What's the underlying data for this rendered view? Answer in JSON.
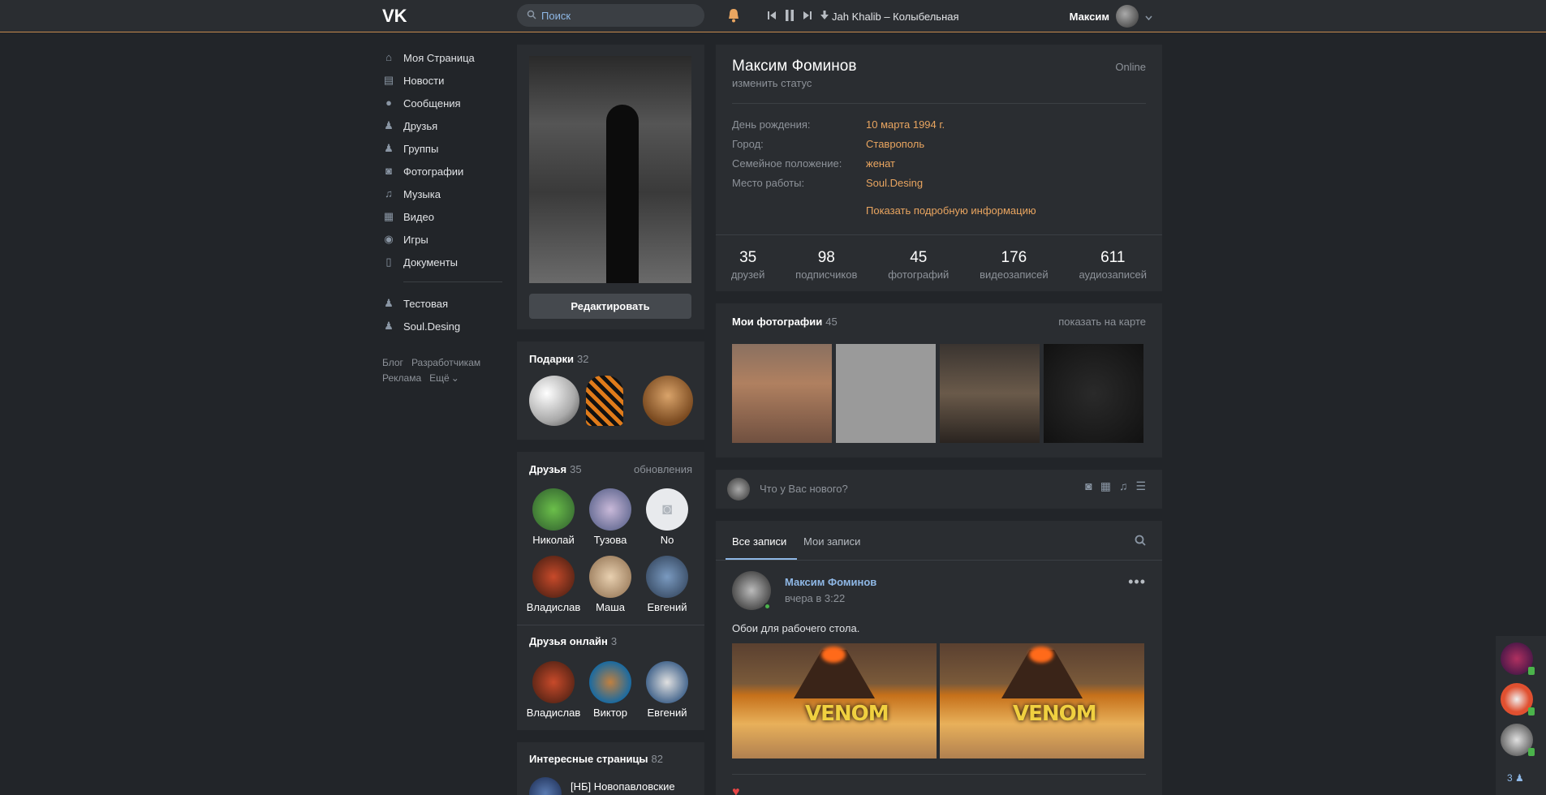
{
  "header": {
    "logo": "VK",
    "search_placeholder": "Поиск",
    "track": "Jah Khalib – Колыбельная",
    "user_name": "Максим"
  },
  "sidebar": {
    "items": [
      {
        "label": "Моя Страница",
        "icon": "home-icon"
      },
      {
        "label": "Новости",
        "icon": "news-icon"
      },
      {
        "label": "Сообщения",
        "icon": "messages-icon"
      },
      {
        "label": "Друзья",
        "icon": "friends-icon"
      },
      {
        "label": "Группы",
        "icon": "groups-icon"
      },
      {
        "label": "Фотографии",
        "icon": "camera-icon"
      },
      {
        "label": "Музыка",
        "icon": "music-icon"
      },
      {
        "label": "Видео",
        "icon": "video-icon"
      },
      {
        "label": "Игры",
        "icon": "games-icon"
      },
      {
        "label": "Документы",
        "icon": "document-icon"
      }
    ],
    "groups": [
      {
        "label": "Тестовая",
        "icon": "group-icon"
      },
      {
        "label": "Soul.Desing",
        "icon": "group-icon"
      }
    ],
    "footer": [
      "Блог",
      "Разработчикам",
      "Реклама",
      "Ещё"
    ]
  },
  "avatar_block": {
    "edit_label": "Редактировать"
  },
  "gifts": {
    "title": "Подарки",
    "count": "32"
  },
  "friends": {
    "title": "Друзья",
    "count": "35",
    "updates": "обновления",
    "list": [
      {
        "name": "Николай"
      },
      {
        "name": "Тузова"
      },
      {
        "name": "No"
      },
      {
        "name": "Владислав"
      },
      {
        "name": "Маша"
      },
      {
        "name": "Евгений"
      }
    ]
  },
  "friends_online": {
    "title": "Друзья онлайн",
    "count": "3",
    "list": [
      {
        "name": "Владислав"
      },
      {
        "name": "Виктор"
      },
      {
        "name": "Евгений"
      }
    ]
  },
  "interesting": {
    "title": "Интересные страницы",
    "count": "82",
    "first": "[НБ] Новопавловские"
  },
  "profile": {
    "name": "Максим Фоминов",
    "status": "изменить статус",
    "online": "Online",
    "info": [
      {
        "key": "День рождения:",
        "value": "10 марта 1994 г."
      },
      {
        "key": "Город:",
        "value": "Ставрополь"
      },
      {
        "key": "Семейное положение:",
        "value": "женат"
      },
      {
        "key": "Место работы:",
        "value": "Soul.Desing"
      }
    ],
    "more": "Показать подробную информацию",
    "stats": [
      {
        "n": "35",
        "l": "друзей"
      },
      {
        "n": "98",
        "l": "подписчиков"
      },
      {
        "n": "45",
        "l": "фотографий"
      },
      {
        "n": "176",
        "l": "видеозаписей"
      },
      {
        "n": "611",
        "l": "аудиозаписей"
      }
    ]
  },
  "photos": {
    "title": "Мои фотографии",
    "count": "45",
    "map": "показать на карте"
  },
  "composer": {
    "placeholder": "Что у Вас нового?"
  },
  "wall": {
    "tabs": [
      "Все записи",
      "Мои записи"
    ],
    "post": {
      "author": "Максим Фоминов",
      "time": "вчера в 3:22",
      "text": "Обои для рабочего стола.",
      "image_text": "VENOM"
    }
  },
  "rail": {
    "count": "3"
  },
  "colors": {
    "accent": "#e9a560",
    "bg": "#222529",
    "panel": "#2a2d31",
    "link": "#8fb8e6"
  }
}
